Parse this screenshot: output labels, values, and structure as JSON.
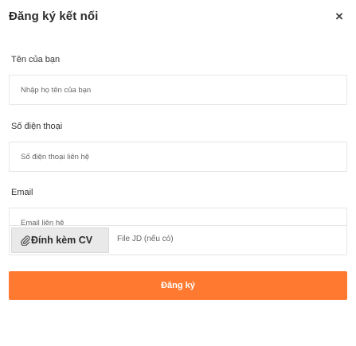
{
  "dialog": {
    "title": "Đăng ký kết nối",
    "close_symbol": "×"
  },
  "form": {
    "name": {
      "label": "Tên của bạn",
      "placeholder": "Nhập họ tên của bạn",
      "value": ""
    },
    "phone": {
      "label": "Số điện thoại",
      "placeholder": "Số điện thoại liên hệ",
      "value": ""
    },
    "email": {
      "label": "Email",
      "placeholder": "Email liên hệ",
      "value": ""
    },
    "attachment": {
      "button_label": "Đính kèm CV",
      "icon": "paperclip-icon",
      "hint": "File JD (nếu có)"
    },
    "submit_label": "Đăng ký"
  },
  "colors": {
    "accent": "#ff7a30",
    "border": "#e6e6e6",
    "attach_bg": "#e9e9e9"
  }
}
